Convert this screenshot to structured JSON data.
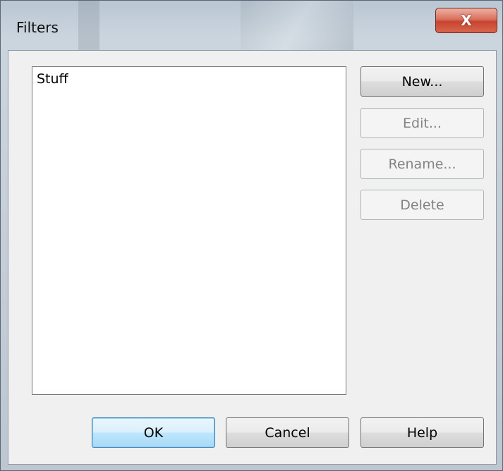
{
  "window": {
    "title": "Filters",
    "close_glyph": "X"
  },
  "list": {
    "items": [
      {
        "label": "Stuff"
      }
    ]
  },
  "side_buttons": {
    "new": "New...",
    "edit": "Edit...",
    "rename": "Rename...",
    "delete": "Delete"
  },
  "footer": {
    "ok": "OK",
    "cancel": "Cancel",
    "help": "Help"
  },
  "colors": {
    "dialog_bg": "#f0f0f0",
    "close_red": "#c74430",
    "default_button": "#bee6fd"
  }
}
